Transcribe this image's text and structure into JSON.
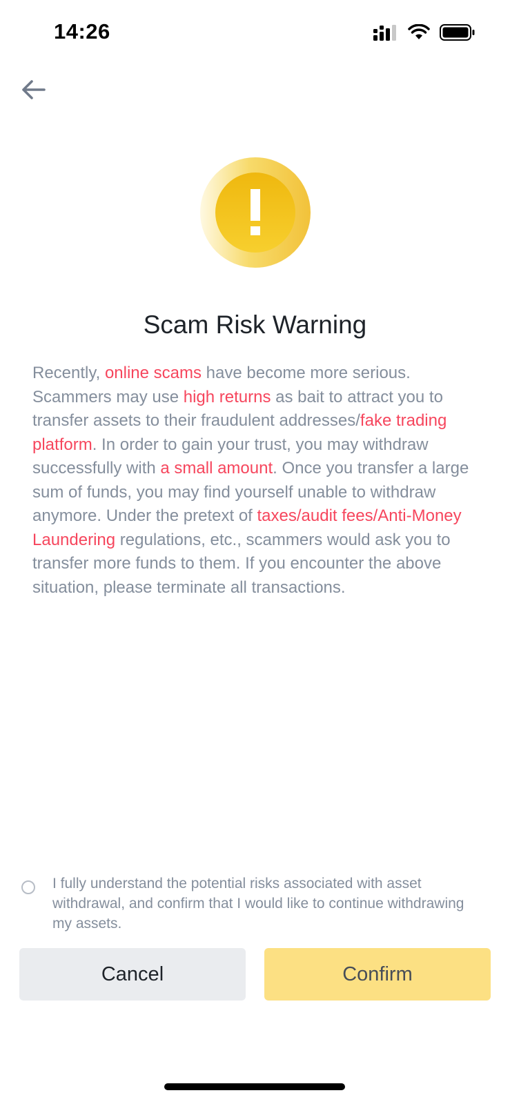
{
  "status_bar": {
    "time": "14:26",
    "icons": [
      "cellular-signal-icon",
      "wifi-icon",
      "battery-icon"
    ]
  },
  "nav": {
    "back_icon": "arrow-left-icon"
  },
  "warning": {
    "icon": "exclamation-warning-icon",
    "icon_color": "#f0b90b",
    "title": "Scam Risk Warning",
    "paragraph": [
      {
        "text": "Recently, ",
        "highlight": false
      },
      {
        "text": "online scams",
        "highlight": true
      },
      {
        "text": " have become more serious. Scammers may use ",
        "highlight": false
      },
      {
        "text": "high returns",
        "highlight": true
      },
      {
        "text": " as bait to attract you to transfer assets to their fraudulent addresses/",
        "highlight": false
      },
      {
        "text": "fake trading platform",
        "highlight": true
      },
      {
        "text": ". In order to gain your trust, you may withdraw successfully with ",
        "highlight": false
      },
      {
        "text": "a small amount",
        "highlight": true
      },
      {
        "text": ". Once you transfer a large sum of funds, you may find yourself unable to withdraw anymore. Under the pretext of ",
        "highlight": false
      },
      {
        "text": "taxes/audit fees/Anti-Money Laundering",
        "highlight": true
      },
      {
        "text": " regulations, etc., scammers would ask you to transfer more funds to them. If you encounter the above situation, please terminate all transactions.",
        "highlight": false
      }
    ],
    "highlight_color": "#f6465d"
  },
  "agreement": {
    "checked": false,
    "text": "I fully understand the potential risks associated with asset withdrawal, and confirm that I would like to continue withdrawing my assets."
  },
  "buttons": {
    "cancel_label": "Cancel",
    "confirm_label": "Confirm",
    "confirm_color": "#fce083"
  }
}
